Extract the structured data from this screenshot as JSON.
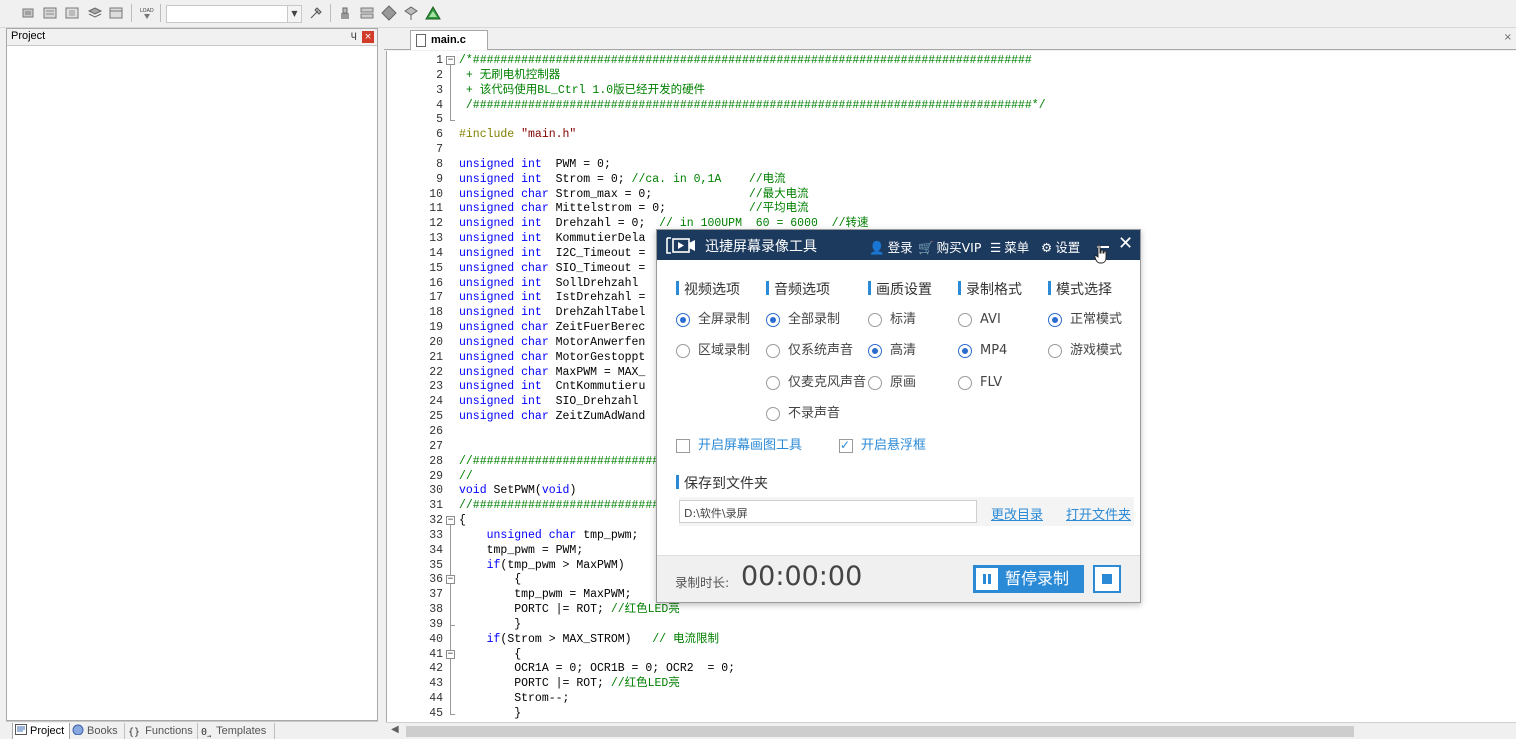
{
  "toolbar": {
    "icons": [
      "translate-icon",
      "batch-build-icon",
      "rebuild-icon",
      "stop-build-icon",
      "batch-setup-icon",
      "load-icon",
      "target-options-icon",
      "manage-components-icon",
      "configure-icon",
      "run-icon",
      "debug-icon",
      "pack-installer-icon"
    ]
  },
  "project_panel": {
    "title": "Project",
    "pin": "ɥ",
    "close": "×"
  },
  "bottom_tabs": [
    {
      "label": "Project",
      "active": true
    },
    {
      "label": "Books",
      "active": false
    },
    {
      "label": "Functions",
      "active": false
    },
    {
      "label": "Templates",
      "active": false
    }
  ],
  "editor": {
    "tab_label": "main.c",
    "close": "×"
  },
  "code": [
    {
      "n": "1",
      "segs": [
        [
          "c",
          "/*#################################################################################"
        ]
      ]
    },
    {
      "n": "2",
      "segs": [
        [
          "c",
          " + 无刷电机控制器"
        ]
      ]
    },
    {
      "n": "3",
      "segs": [
        [
          "c",
          " + 该代码使用BL_Ctrl 1.0版已经开发的硬件"
        ]
      ]
    },
    {
      "n": "4",
      "segs": [
        [
          "c",
          " /#################################################################################*/"
        ]
      ]
    },
    {
      "n": "5",
      "segs": [
        [
          "p",
          ""
        ]
      ]
    },
    {
      "n": "6",
      "segs": [
        [
          "d",
          "#include "
        ],
        [
          "s",
          "\"main.h\""
        ]
      ]
    },
    {
      "n": "7",
      "segs": [
        [
          "p",
          ""
        ]
      ]
    },
    {
      "n": "8",
      "segs": [
        [
          "k",
          "unsigned int"
        ],
        [
          "p",
          "  PWM = 0;"
        ]
      ]
    },
    {
      "n": "9",
      "segs": [
        [
          "k",
          "unsigned int"
        ],
        [
          "p",
          "  Strom = 0; "
        ],
        [
          "c",
          "//ca. in 0,1A    //电流"
        ]
      ]
    },
    {
      "n": "10",
      "segs": [
        [
          "k",
          "unsigned char"
        ],
        [
          "p",
          " Strom_max = 0;              "
        ],
        [
          "c",
          "//最大电流"
        ]
      ]
    },
    {
      "n": "11",
      "segs": [
        [
          "k",
          "unsigned char"
        ],
        [
          "p",
          " Mittelstrom = 0;            "
        ],
        [
          "c",
          "//平均电流"
        ]
      ]
    },
    {
      "n": "12",
      "segs": [
        [
          "k",
          "unsigned int"
        ],
        [
          "p",
          "  Drehzahl = 0;  "
        ],
        [
          "c",
          "// in 100UPM  60 = 6000  //转速"
        ]
      ]
    },
    {
      "n": "13",
      "segs": [
        [
          "k",
          "unsigned int"
        ],
        [
          "p",
          "  KommutierDela"
        ]
      ]
    },
    {
      "n": "14",
      "segs": [
        [
          "k",
          "unsigned int"
        ],
        [
          "p",
          "  I2C_Timeout ="
        ]
      ]
    },
    {
      "n": "15",
      "segs": [
        [
          "k",
          "unsigned char"
        ],
        [
          "p",
          " SIO_Timeout ="
        ]
      ]
    },
    {
      "n": "16",
      "segs": [
        [
          "k",
          "unsigned int"
        ],
        [
          "p",
          "  SollDrehzahl"
        ]
      ]
    },
    {
      "n": "17",
      "segs": [
        [
          "k",
          "unsigned int"
        ],
        [
          "p",
          "  IstDrehzahl ="
        ]
      ]
    },
    {
      "n": "18",
      "segs": [
        [
          "k",
          "unsigned int"
        ],
        [
          "p",
          "  DrehZahlTabel"
        ]
      ]
    },
    {
      "n": "19",
      "segs": [
        [
          "k",
          "unsigned char"
        ],
        [
          "p",
          " ZeitFuerBerec"
        ]
      ]
    },
    {
      "n": "20",
      "segs": [
        [
          "k",
          "unsigned char"
        ],
        [
          "p",
          " MotorAnwerfen"
        ]
      ]
    },
    {
      "n": "21",
      "segs": [
        [
          "k",
          "unsigned char"
        ],
        [
          "p",
          " MotorGestoppt"
        ]
      ]
    },
    {
      "n": "22",
      "segs": [
        [
          "k",
          "unsigned char"
        ],
        [
          "p",
          " MaxPWM = MAX_"
        ]
      ]
    },
    {
      "n": "23",
      "segs": [
        [
          "k",
          "unsigned int"
        ],
        [
          "p",
          "  CntKommutieru"
        ]
      ]
    },
    {
      "n": "24",
      "segs": [
        [
          "k",
          "unsigned int"
        ],
        [
          "p",
          "  SIO_Drehzahl"
        ]
      ]
    },
    {
      "n": "25",
      "segs": [
        [
          "k",
          "unsigned char"
        ],
        [
          "p",
          " ZeitZumAdWand"
        ]
      ]
    },
    {
      "n": "26",
      "segs": [
        [
          "p",
          ""
        ]
      ]
    },
    {
      "n": "27",
      "segs": [
        [
          "p",
          ""
        ]
      ]
    },
    {
      "n": "28",
      "segs": [
        [
          "c",
          "//###########################"
        ]
      ]
    },
    {
      "n": "29",
      "segs": [
        [
          "c",
          "//"
        ]
      ]
    },
    {
      "n": "30",
      "segs": [
        [
          "k",
          "void"
        ],
        [
          "p",
          " SetPWM("
        ],
        [
          "k",
          "void"
        ],
        [
          "p",
          ")"
        ]
      ]
    },
    {
      "n": "31",
      "segs": [
        [
          "c",
          "//###########################"
        ]
      ]
    },
    {
      "n": "32",
      "segs": [
        [
          "p",
          "{"
        ]
      ]
    },
    {
      "n": "33",
      "segs": [
        [
          "p",
          "    "
        ],
        [
          "k",
          "unsigned char"
        ],
        [
          "p",
          " tmp_pwm;"
        ]
      ]
    },
    {
      "n": "34",
      "segs": [
        [
          "p",
          "    tmp_pwm = PWM;"
        ]
      ]
    },
    {
      "n": "35",
      "segs": [
        [
          "p",
          "    "
        ],
        [
          "k",
          "if"
        ],
        [
          "p",
          "(tmp_pwm > MaxPWM)"
        ]
      ]
    },
    {
      "n": "36",
      "segs": [
        [
          "p",
          "        {"
        ]
      ]
    },
    {
      "n": "37",
      "segs": [
        [
          "p",
          "        tmp_pwm = MaxPWM;"
        ]
      ]
    },
    {
      "n": "38",
      "segs": [
        [
          "p",
          "        PORTC |= ROT; "
        ],
        [
          "c",
          "//红色LED亮"
        ]
      ]
    },
    {
      "n": "39",
      "segs": [
        [
          "p",
          "        }"
        ]
      ]
    },
    {
      "n": "40",
      "segs": [
        [
          "p",
          "    "
        ],
        [
          "k",
          "if"
        ],
        [
          "p",
          "(Strom > MAX_STROM)   "
        ],
        [
          "c",
          "// 电流限制"
        ]
      ]
    },
    {
      "n": "41",
      "segs": [
        [
          "p",
          "        {"
        ]
      ]
    },
    {
      "n": "42",
      "segs": [
        [
          "p",
          "        OCR1A = 0; OCR1B = 0; OCR2  = 0;"
        ]
      ]
    },
    {
      "n": "43",
      "segs": [
        [
          "p",
          "        PORTC |= ROT; "
        ],
        [
          "c",
          "//红色LED亮"
        ]
      ]
    },
    {
      "n": "44",
      "segs": [
        [
          "p",
          "        Strom--;"
        ]
      ]
    },
    {
      "n": "45",
      "segs": [
        [
          "p",
          "        }"
        ]
      ]
    }
  ],
  "colors": {
    "keyword": "#0000ff",
    "comment": "#008000",
    "preprocessor": "#808000",
    "string": "#800000",
    "plain": "#000000",
    "recorder_header": "#1c3a5e",
    "recorder_accent": "#2b8ad6"
  },
  "recorder": {
    "title": "迅捷屏幕录像工具",
    "nav": {
      "login": "登录",
      "vip": "购买VIP",
      "menu": "菜单",
      "settings": "设置"
    },
    "sections": {
      "video": "视频选项",
      "audio": "音频选项",
      "quality": "画质设置",
      "format": "录制格式",
      "mode": "模式选择"
    },
    "video_options": [
      {
        "label": "全屏录制",
        "selected": true
      },
      {
        "label": "区域录制",
        "selected": false
      }
    ],
    "audio_options": [
      {
        "label": "全部录制",
        "selected": true
      },
      {
        "label": "仅系统声音",
        "selected": false
      },
      {
        "label": "仅麦克风声音",
        "selected": false
      },
      {
        "label": "不录声音",
        "selected": false
      }
    ],
    "quality_options": [
      {
        "label": "标清",
        "selected": false
      },
      {
        "label": "高清",
        "selected": true
      },
      {
        "label": "原画",
        "selected": false
      }
    ],
    "format_options": [
      {
        "label": "AVI",
        "selected": false
      },
      {
        "label": "MP4",
        "selected": true
      },
      {
        "label": "FLV",
        "selected": false
      }
    ],
    "mode_options": [
      {
        "label": "正常模式",
        "selected": true
      },
      {
        "label": "游戏模式",
        "selected": false
      }
    ],
    "checkboxes": {
      "draw_tool": {
        "label": "开启屏幕画图工具",
        "checked": false
      },
      "float_box": {
        "label": "开启悬浮框",
        "checked": true
      }
    },
    "save": {
      "heading": "保存到文件夹",
      "path": "D:\\软件\\录屏",
      "change_dir": "更改目录",
      "open_folder": "打开文件夹"
    },
    "footer": {
      "duration_label": "录制时长:",
      "duration": "00:00:00",
      "pause_label": "暂停录制"
    }
  }
}
